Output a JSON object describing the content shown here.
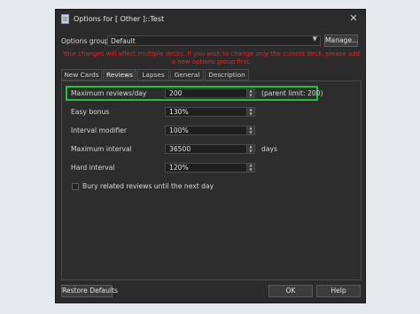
{
  "window": {
    "title": "Options for [ Other ]::Test"
  },
  "options_group": {
    "label": "Options group:",
    "value": "Default",
    "manage_label": "Manage..."
  },
  "warning": "Your changes will affect multiple decks. If you wish to change only the current deck, please add a new options group first.",
  "tabs": [
    {
      "label": "New Cards",
      "active": false
    },
    {
      "label": "Reviews",
      "active": true
    },
    {
      "label": "Lapses",
      "active": false
    },
    {
      "label": "General",
      "active": false
    },
    {
      "label": "Description",
      "active": false
    }
  ],
  "reviews": {
    "max_reviews": {
      "label": "Maximum reviews/day",
      "value": "200",
      "note": "(parent limit: 200)"
    },
    "easy_bonus": {
      "label": "Easy bonus",
      "value": "130%"
    },
    "interval_modifier": {
      "label": "Interval modifier",
      "value": "100%"
    },
    "max_interval": {
      "label": "Maximum interval",
      "value": "36500",
      "unit": "days"
    },
    "hard_interval": {
      "label": "Hard interval",
      "value": "120%"
    },
    "bury": {
      "label": "Bury related reviews until the next day",
      "checked": false
    }
  },
  "footer": {
    "restore_label": "Restore Defaults",
    "ok_label": "OK",
    "help_label": "Help"
  },
  "colors": {
    "highlight": "#23c13b",
    "warning": "#dd2a2a",
    "window_bg": "#2b2b2b"
  }
}
